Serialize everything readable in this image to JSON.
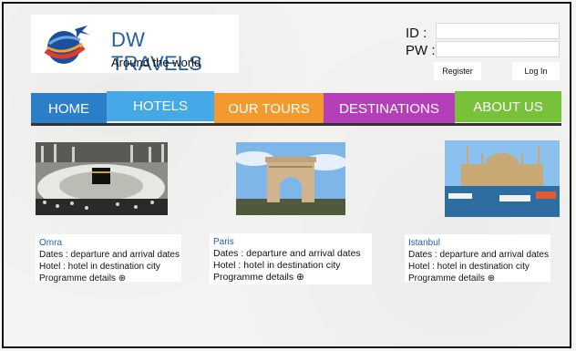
{
  "brand": {
    "title": "DW TRAVELS",
    "subtitle": "Around the world"
  },
  "login": {
    "id_label": "ID :",
    "pw_label": "PW :",
    "id_value": "",
    "pw_value": "",
    "register_label": "Register",
    "login_label": "Log In"
  },
  "nav": {
    "items": [
      {
        "label": "HOME",
        "color": "#2b7fc8"
      },
      {
        "label": "HOTELS",
        "color": "#44a9e6"
      },
      {
        "label": "OUR TOURS",
        "color": "#f39a2e"
      },
      {
        "label": "DESTINATIONS",
        "color": "#b43fb9"
      },
      {
        "label": "ABOUT US",
        "color": "#78c23a"
      }
    ]
  },
  "cards": [
    {
      "city": "Omra",
      "dates": "Dates : departure and arrival dates",
      "hotel": "Hotel : hotel in destination city",
      "details": "Programme details ⊕"
    },
    {
      "city": "Paris",
      "dates": "Dates : departure and arrival dates",
      "hotel": "Hotel : hotel in destination city",
      "details": "Programme details ⊕"
    },
    {
      "city": "Istanbul",
      "dates": "Dates : departure and arrival dates",
      "hotel": "Hotel : hotel in destination city",
      "details": "Programme details ⊕"
    }
  ]
}
